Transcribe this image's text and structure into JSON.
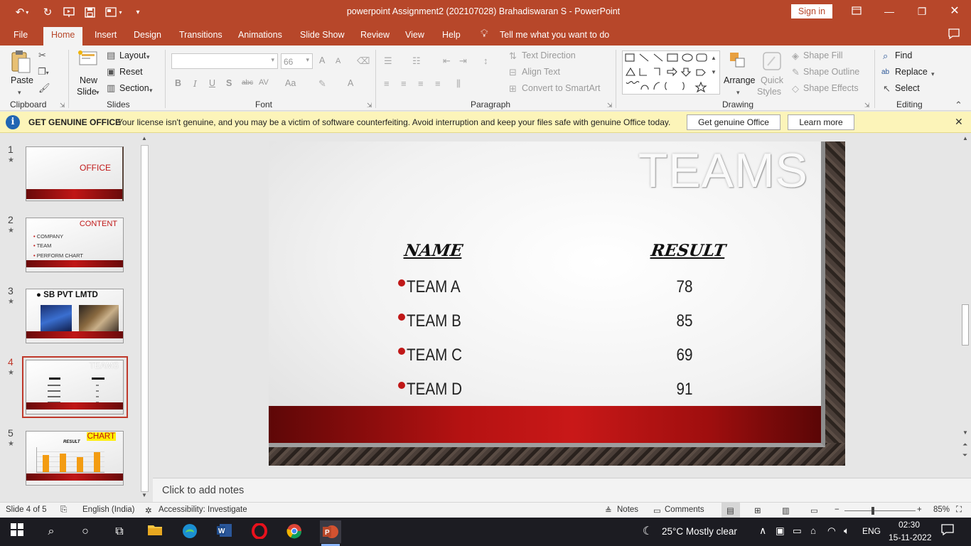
{
  "window": {
    "title": "powerpoint Assignment2 (202107028) Brahadiswaran S  -  PowerPoint",
    "sign_in": "Sign in"
  },
  "tabs": [
    "File",
    "Home",
    "Insert",
    "Design",
    "Transitions",
    "Animations",
    "Slide Show",
    "Review",
    "View",
    "Help"
  ],
  "active_tab": "Home",
  "tell_me": "Tell me what you want to do",
  "ribbon": {
    "clipboard": {
      "group": "Clipboard",
      "paste": "Paste"
    },
    "slides": {
      "group": "Slides",
      "new_slide_1": "New",
      "new_slide_2": "Slide",
      "layout": "Layout",
      "reset": "Reset",
      "section": "Section"
    },
    "font": {
      "group": "Font",
      "size": "66",
      "bold": "B",
      "italic": "I",
      "underline": "U",
      "shadow": "S",
      "strike": "abc",
      "spacing": "AV",
      "case": "Aa",
      "color": "A",
      "grow": "A",
      "shrink": "A"
    },
    "paragraph": {
      "group": "Paragraph",
      "text_direction": "Text Direction",
      "align_text": "Align Text",
      "smartart": "Convert to SmartArt"
    },
    "drawing": {
      "group": "Drawing",
      "arrange": "Arrange",
      "quick_1": "Quick",
      "quick_2": "Styles",
      "shape_fill": "Shape Fill",
      "shape_outline": "Shape Outline",
      "shape_effects": "Shape Effects"
    },
    "editing": {
      "group": "Editing",
      "find": "Find",
      "replace": "Replace",
      "select": "Select"
    }
  },
  "license": {
    "heading": "GET GENUINE OFFICE",
    "message": "Your license isn't genuine, and you may be a victim of software counterfeiting. Avoid interruption and keep your files safe with genuine Office today.",
    "get_button": "Get genuine Office",
    "learn_button": "Learn more"
  },
  "thumbnails": {
    "numbers": [
      "1",
      "2",
      "3",
      "4",
      "5"
    ],
    "s1_title": "OFFICE",
    "s2_title": "CONTENT",
    "s2_items": [
      "COMPANY",
      "TEAM",
      "PERFORM CHART"
    ],
    "s3_title": "SB PVT LMTD",
    "s4_title": "TEAMS",
    "s5_title": "CHART",
    "s5_sub": "RESULT"
  },
  "slide": {
    "title": "TEAMS",
    "col_name": "NAME",
    "col_result": "RESULT",
    "rows": [
      {
        "team": "TEAM A",
        "score": "78"
      },
      {
        "team": "TEAM B",
        "score": "85"
      },
      {
        "team": "TEAM C",
        "score": "69"
      },
      {
        "team": "TEAM D",
        "score": "91"
      }
    ]
  },
  "notes_placeholder": "Click to add notes",
  "status": {
    "slide": "Slide 4 of 5",
    "language": "English (India)",
    "accessibility": "Accessibility: Investigate",
    "notes": "Notes",
    "comments": "Comments",
    "zoom": "85%"
  },
  "taskbar": {
    "weather": "25°C  Mostly clear",
    "lang": "ENG",
    "time": "02:30",
    "date": "15-11-2022"
  },
  "colors": {
    "accent": "#b7472a",
    "license_bg": "#fcf4b9",
    "slide_band": "#c01818",
    "taskbar": "#1c1c22"
  }
}
